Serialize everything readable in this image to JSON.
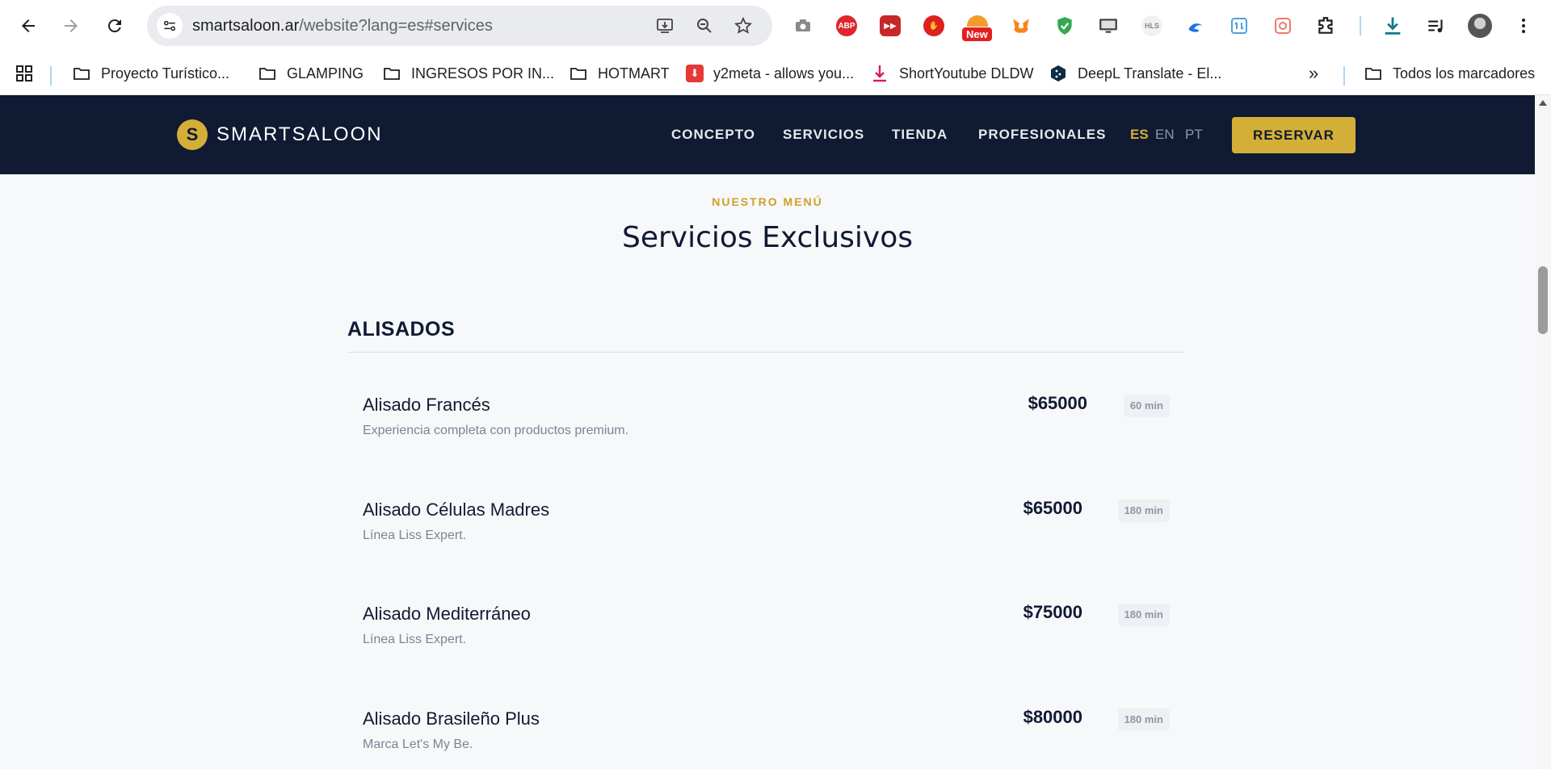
{
  "browser": {
    "url_host": "smartsaloon.ar",
    "url_path": "/website?lang=es#services",
    "new_badge": "New",
    "extensions": [
      {
        "name": "camera-extension",
        "color": "#8a8a8a",
        "label": ""
      },
      {
        "name": "adblock-plus-extension",
        "color": "#e0262b",
        "label": "ABP"
      },
      {
        "name": "media-skip-extension",
        "color": "#c62828",
        "label": "▶"
      },
      {
        "name": "stop-hand-extension",
        "color": "#e02020",
        "label": "✋"
      },
      {
        "name": "new-extension",
        "color": "#e45525",
        "label": ""
      },
      {
        "name": "metamask-extension",
        "color": "#f6851b",
        "label": ""
      },
      {
        "name": "shield-extension",
        "color": "#34a853",
        "label": "✓"
      },
      {
        "name": "monitor-extension",
        "color": "#4a4a4a",
        "label": ""
      },
      {
        "name": "hls-extension",
        "color": "#d0d0d0",
        "label": "HLS"
      },
      {
        "name": "swirl-extension",
        "color": "#1a73e8",
        "label": ""
      },
      {
        "name": "sync-extension",
        "color": "#4aa3df",
        "label": ""
      },
      {
        "name": "search-gradient-extension",
        "color": "#f0776c",
        "label": ""
      }
    ]
  },
  "bookmarks": [
    {
      "label": "Proyecto Turístico...",
      "type": "folder"
    },
    {
      "label": "GLAMPING",
      "type": "folder"
    },
    {
      "label": "INGRESOS POR IN...",
      "type": "folder"
    },
    {
      "label": "HOTMART",
      "type": "folder"
    },
    {
      "label": "y2meta - allows you...",
      "type": "site"
    },
    {
      "label": "ShortYoutube DLDW",
      "type": "site"
    },
    {
      "label": "DeepL Translate - El...",
      "type": "site"
    },
    {
      "label": "Todos los marcadores",
      "type": "folder"
    }
  ],
  "site": {
    "logo_letter": "S",
    "logo_text": "SMARTSALOON",
    "nav": [
      "CONCEPTO",
      "SERVICIOS",
      "TIENDA",
      "PROFESIONALES"
    ],
    "languages": [
      "ES",
      "EN",
      "PT"
    ],
    "active_language": "ES",
    "cta": "RESERVAR",
    "accent_color": "#d4af37",
    "header_color": "#111a33"
  },
  "services_section": {
    "eyebrow": "NUESTRO MENÚ",
    "title": "Servicios Exclusivos",
    "category": "ALISADOS",
    "items": [
      {
        "name": "Alisado Francés",
        "description": "Experiencia completa con productos premium.",
        "price": "$65000",
        "duration": "60 min"
      },
      {
        "name": "Alisado Células Madres",
        "description": "Línea Liss Expert.",
        "price": "$65000",
        "duration": "180 min"
      },
      {
        "name": "Alisado Mediterráneo",
        "description": "Línea Liss Expert.",
        "price": "$75000",
        "duration": "180 min"
      },
      {
        "name": "Alisado Brasileño Plus",
        "description": "Marca Let's My Be.",
        "price": "$80000",
        "duration": "180 min"
      }
    ]
  }
}
